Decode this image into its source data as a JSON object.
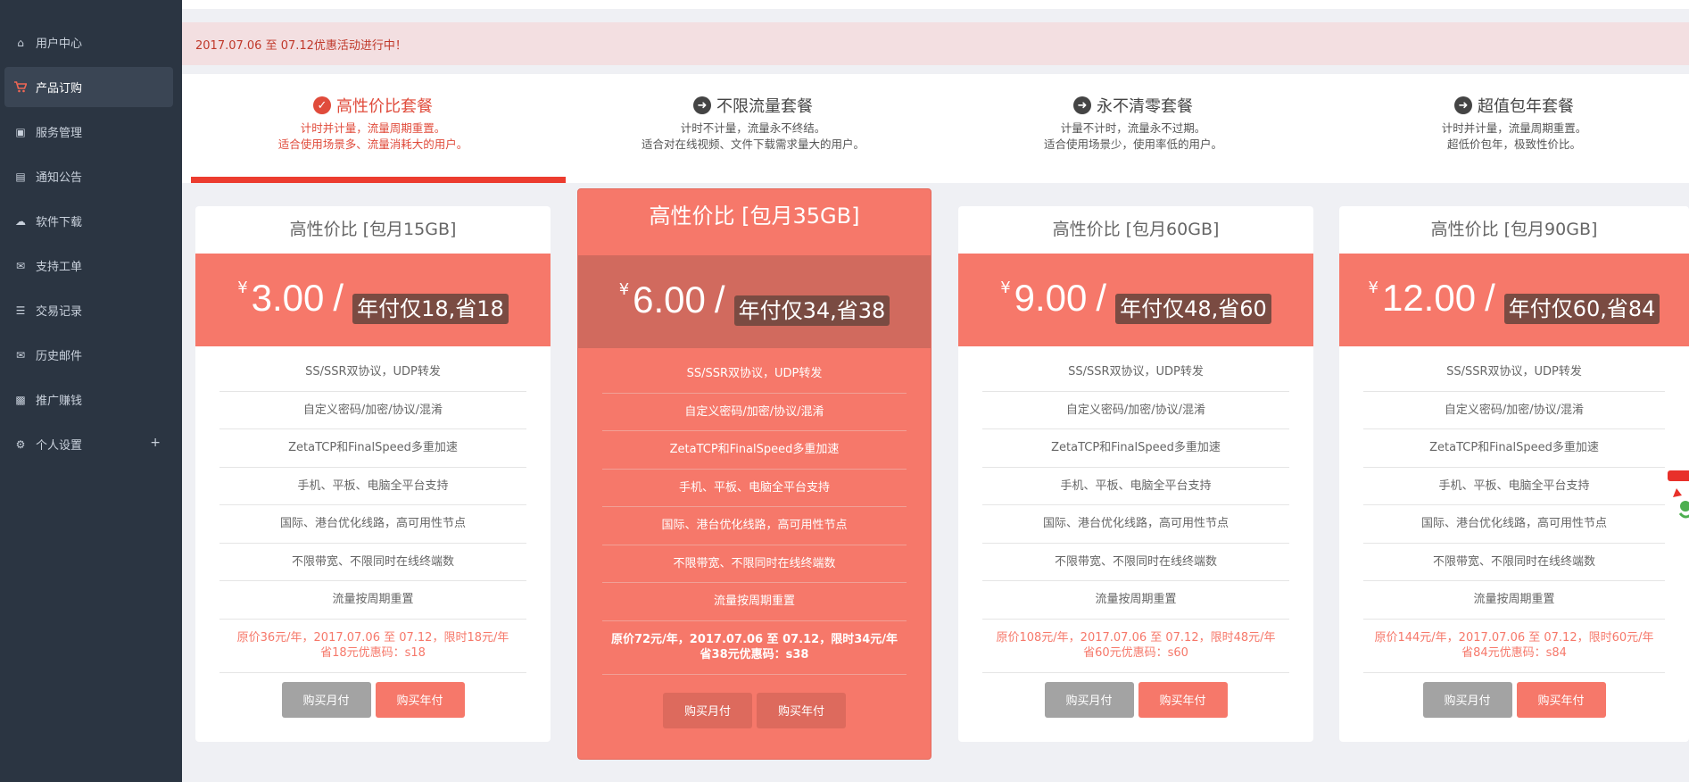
{
  "sidebar": {
    "items": [
      {
        "label": "用户中心",
        "icon": "home-icon"
      },
      {
        "label": "产品订购",
        "icon": "cart-icon",
        "active": true
      },
      {
        "label": "服务管理",
        "icon": "cube-icon"
      },
      {
        "label": "通知公告",
        "icon": "newspaper-icon"
      },
      {
        "label": "软件下载",
        "icon": "cloud-download-icon"
      },
      {
        "label": "支持工单",
        "icon": "comments-icon"
      },
      {
        "label": "交易记录",
        "icon": "list-icon"
      },
      {
        "label": "历史邮件",
        "icon": "envelope-icon"
      },
      {
        "label": "推广赚钱",
        "icon": "gift-icon"
      },
      {
        "label": "个人设置",
        "icon": "gear-icon",
        "expand": "+"
      }
    ]
  },
  "notice": {
    "text": "2017.07.06 至 07.12优惠活动进行中！"
  },
  "tabs": [
    {
      "title": "高性价比套餐",
      "desc1": "计时并计量，流量周期重置。",
      "desc2": "适合使用场景多、流量消耗大的用户。",
      "icon": "check-circle-icon",
      "active": true
    },
    {
      "title": "不限流量套餐",
      "desc1": "计时不计量，流量永不终结。",
      "desc2": "适合对在线视频、文件下载需求量大的用户。",
      "icon": "arrow-circle-right-icon"
    },
    {
      "title": "永不清零套餐",
      "desc1": "计量不计时，流量永不过期。",
      "desc2": "适合使用场景少，使用率低的用户。",
      "icon": "arrow-circle-right-icon"
    },
    {
      "title": "超值包年套餐",
      "desc1": "计时并计量，流量周期重置。",
      "desc2": "超低价包年，极致性价比。",
      "icon": "arrow-circle-right-icon"
    }
  ],
  "features": [
    "SS/SSR双协议，UDP转发",
    "自定义密码/加密/协议/混淆",
    "ZetaTCP和FinalSpeed多重加速",
    "手机、平板、电脑全平台支持",
    "国际、港台优化线路，高可用性节点",
    "不限带宽、不限同时在线终端数",
    "流量按周期重置"
  ],
  "plans": [
    {
      "title": "高性价比 [包月15GB]",
      "currency": "¥",
      "price": "3.00",
      "slash": "/",
      "badge": "年付仅18,省18",
      "promo1": "原价36元/年，2017.07.06 至 07.12，限时18元/年",
      "promo2": "省18元优惠码：s18",
      "btn_month": "购买月付",
      "btn_year": "购买年付"
    },
    {
      "title": "高性价比 [包月35GB]",
      "currency": "¥",
      "price": "6.00",
      "slash": "/",
      "badge": "年付仅34,省38",
      "promo1": "原价72元/年，2017.07.06 至 07.12，限时34元/年",
      "promo2": "省38元优惠码：s38",
      "btn_month": "购买月付",
      "btn_year": "购买年付"
    },
    {
      "title": "高性价比 [包月60GB]",
      "currency": "¥",
      "price": "9.00",
      "slash": "/",
      "badge": "年付仅48,省60",
      "promo1": "原价108元/年，2017.07.06 至 07.12，限时48元/年",
      "promo2": "省60元优惠码：s60",
      "btn_month": "购买月付",
      "btn_year": "购买年付"
    },
    {
      "title": "高性价比 [包月90GB]",
      "currency": "¥",
      "price": "12.00",
      "slash": "/",
      "badge": "年付仅60,省84",
      "promo1": "原价144元/年，2017.07.06 至 07.12，限时60元/年",
      "promo2": "省84元优惠码：s84",
      "btn_month": "购买月付",
      "btn_year": "购买年付"
    }
  ]
}
